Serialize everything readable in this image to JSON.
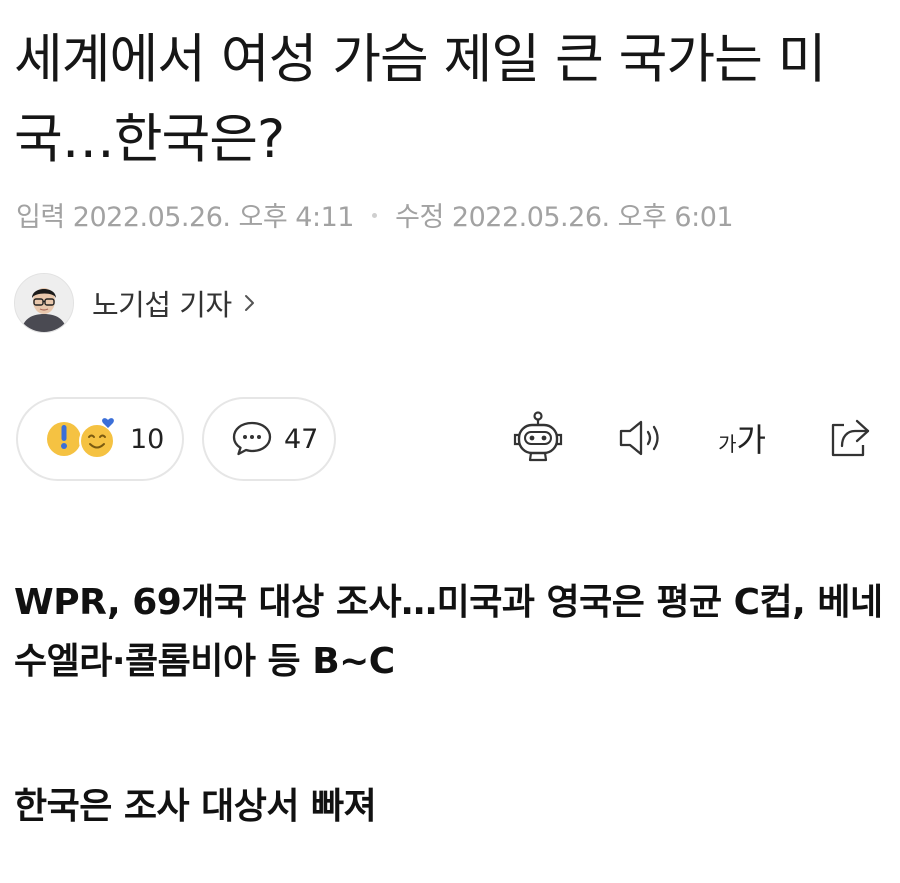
{
  "article": {
    "headline": "세계에서 여성 가슴 제일 큰 국가는 미국…한국은?",
    "dates": {
      "input_label": "입력",
      "input_value": "2022.05.26. 오후 4:11",
      "edit_label": "수정",
      "edit_value": "2022.05.26. 오후 6:01"
    },
    "author": {
      "name": "노기섭 기자"
    },
    "reactions": {
      "count": "10"
    },
    "comments": {
      "count": "47"
    },
    "font_size_label_small": "가",
    "font_size_label_large": "가",
    "subheadings": [
      "WPR, 69개국 대상 조사…미국과 영국은 평균 C컵, 베네수엘라·콜롬비아 등 B~C",
      "한국은 조사 대상서 빠져"
    ]
  },
  "icons": {
    "reaction": "reaction-emoji-icon",
    "comment": "speech-bubble-icon",
    "summary_bot": "robot-icon",
    "audio": "speaker-icon",
    "font_size": "font-size-icon",
    "share": "share-icon",
    "author_link": "chevron-right-icon"
  },
  "colors": {
    "text": "#161616",
    "meta": "#a2a2a2",
    "pill_border": "#e6e6e6",
    "emoji_yellow": "#f5c242",
    "emoji_blue": "#3b6fd8"
  }
}
